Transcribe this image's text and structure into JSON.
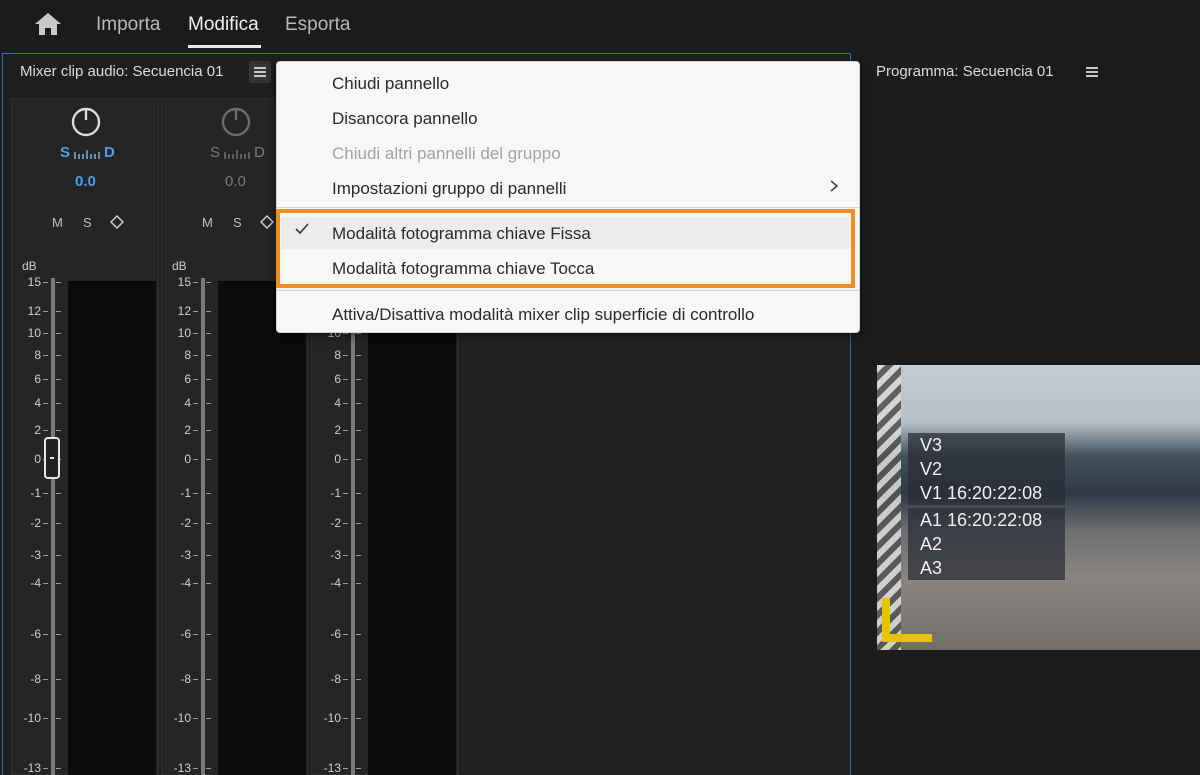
{
  "nav": {
    "tabs": [
      "Importa",
      "Modifica",
      "Esporta"
    ],
    "active_tab": "Modifica",
    "home_icon": "home-icon"
  },
  "audio_mixer": {
    "title": "Mixer clip audio: Secuencia 01",
    "menu_icon": "hamburger-menu-icon",
    "channels": [
      {
        "pan_left": "S",
        "pan_right": "D",
        "pan_value": "0.0",
        "active": true,
        "buttons": [
          "M",
          "S"
        ]
      },
      {
        "pan_left": "S",
        "pan_right": "D",
        "pan_value": "0.0",
        "active": false,
        "buttons": [
          "M",
          "S"
        ]
      },
      {
        "pan_left": "",
        "pan_right": "",
        "pan_value": "",
        "active": false,
        "buttons": []
      }
    ],
    "db_label": "dB",
    "scale": [
      "15",
      "12",
      "10",
      "8",
      "6",
      "4",
      "2",
      "0",
      "-1",
      "-2",
      "-3",
      "-4",
      "-6",
      "-8",
      "-10",
      "-13"
    ]
  },
  "program_monitor": {
    "title": "Programma: Secuencia 01",
    "menu_icon": "hamburger-menu-icon",
    "overlay_tracks": [
      "V3",
      "V2",
      "V1 16:20:22:08",
      "A1 16:20:22:08",
      "A2",
      "A3"
    ]
  },
  "context_menu": {
    "items": [
      {
        "label": "Chiudi pannello",
        "enabled": true
      },
      {
        "label": "Disancora pannello",
        "enabled": true
      },
      {
        "label": "Chiudi altri pannelli del gruppo",
        "enabled": false
      },
      {
        "label": "Impostazioni gruppo di pannelli",
        "enabled": true,
        "submenu": true
      },
      {
        "label": "Modalità fotogramma chiave Fissa",
        "enabled": true,
        "checked": true
      },
      {
        "label": "Modalità fotogramma chiave Tocca",
        "enabled": true
      },
      {
        "label": "Attiva/Disattiva modalità mixer clip superficie di controllo",
        "enabled": true
      }
    ]
  },
  "colors": {
    "accent_blue": "#4d9df0",
    "highlight_orange": "#ef8f1f",
    "marker_yellow": "#e6c400"
  }
}
